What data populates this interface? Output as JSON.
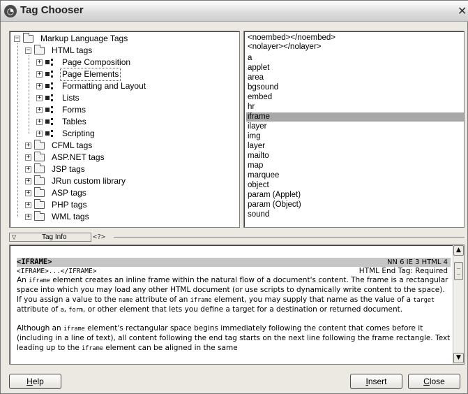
{
  "window": {
    "title": "Tag Chooser",
    "title_icon": "dreamweaver-app-icon",
    "close_glyph": "✕"
  },
  "tree": {
    "root": "Markup Language Tags",
    "html_tags": "HTML tags",
    "html_children": [
      "Page Composition",
      "Page Elements",
      "Formatting and Layout",
      "Lists",
      "Forms",
      "Tables",
      "Scripting"
    ],
    "other_groups": [
      "CFML tags",
      "ASP.NET tags",
      "JSP tags",
      "JRun custom library",
      "ASP tags",
      "PHP tags",
      "WML tags"
    ],
    "selected": "Page Elements"
  },
  "tag_list": {
    "items": [
      "<noembed></noembed>",
      "<nolayer></nolayer>",
      "a",
      "applet",
      "area",
      "bgsound",
      "embed",
      "hr",
      "iframe",
      "ilayer",
      "img",
      "layer",
      "mailto",
      "map",
      "marquee",
      "object",
      "param (Applet)",
      "param (Object)",
      "sound"
    ],
    "selected": "iframe"
  },
  "tag_info": {
    "toggle_label": "Tag Info",
    "help_glyph": "<?>"
  },
  "reference": {
    "tag_name": "<IFRAME>",
    "browser_support": "NN 6 IE 3 HTML 4",
    "syntax": "<IFRAME>...</IFRAME>",
    "end_tag": "HTML End Tag: Required",
    "p1": {
      "a": "An ",
      "code1": "iframe",
      "b": " element creates an inline frame within the natural flow of a document's content. The frame is a rectangular space into which you may load any other HTML document (or use scripts to dynamically write content to the space). If you assign a value to the ",
      "code2": "name",
      "c": " attribute of an ",
      "code3": "iframe",
      "d": " element, you may supply that name as the value of a ",
      "code4": "target",
      "e": " attribute of ",
      "code5": "a",
      "f": ", ",
      "code6": "form",
      "g": ", or other element that lets you define a target for a destination or returned document."
    },
    "p2": {
      "a": "Although an ",
      "code1": "iframe",
      "b": " element's rectangular space begins immediately following the content that comes before it (including in a line of text), all content following the end tag starts on the next line following the frame rectangle. Text leading up to the ",
      "code2": "iframe",
      "c": " element can be aligned in the same"
    }
  },
  "buttons": {
    "help": {
      "u": "H",
      "rest": "elp"
    },
    "insert": {
      "u": "I",
      "rest": "nsert"
    },
    "close": {
      "u": "C",
      "rest": "lose"
    }
  }
}
